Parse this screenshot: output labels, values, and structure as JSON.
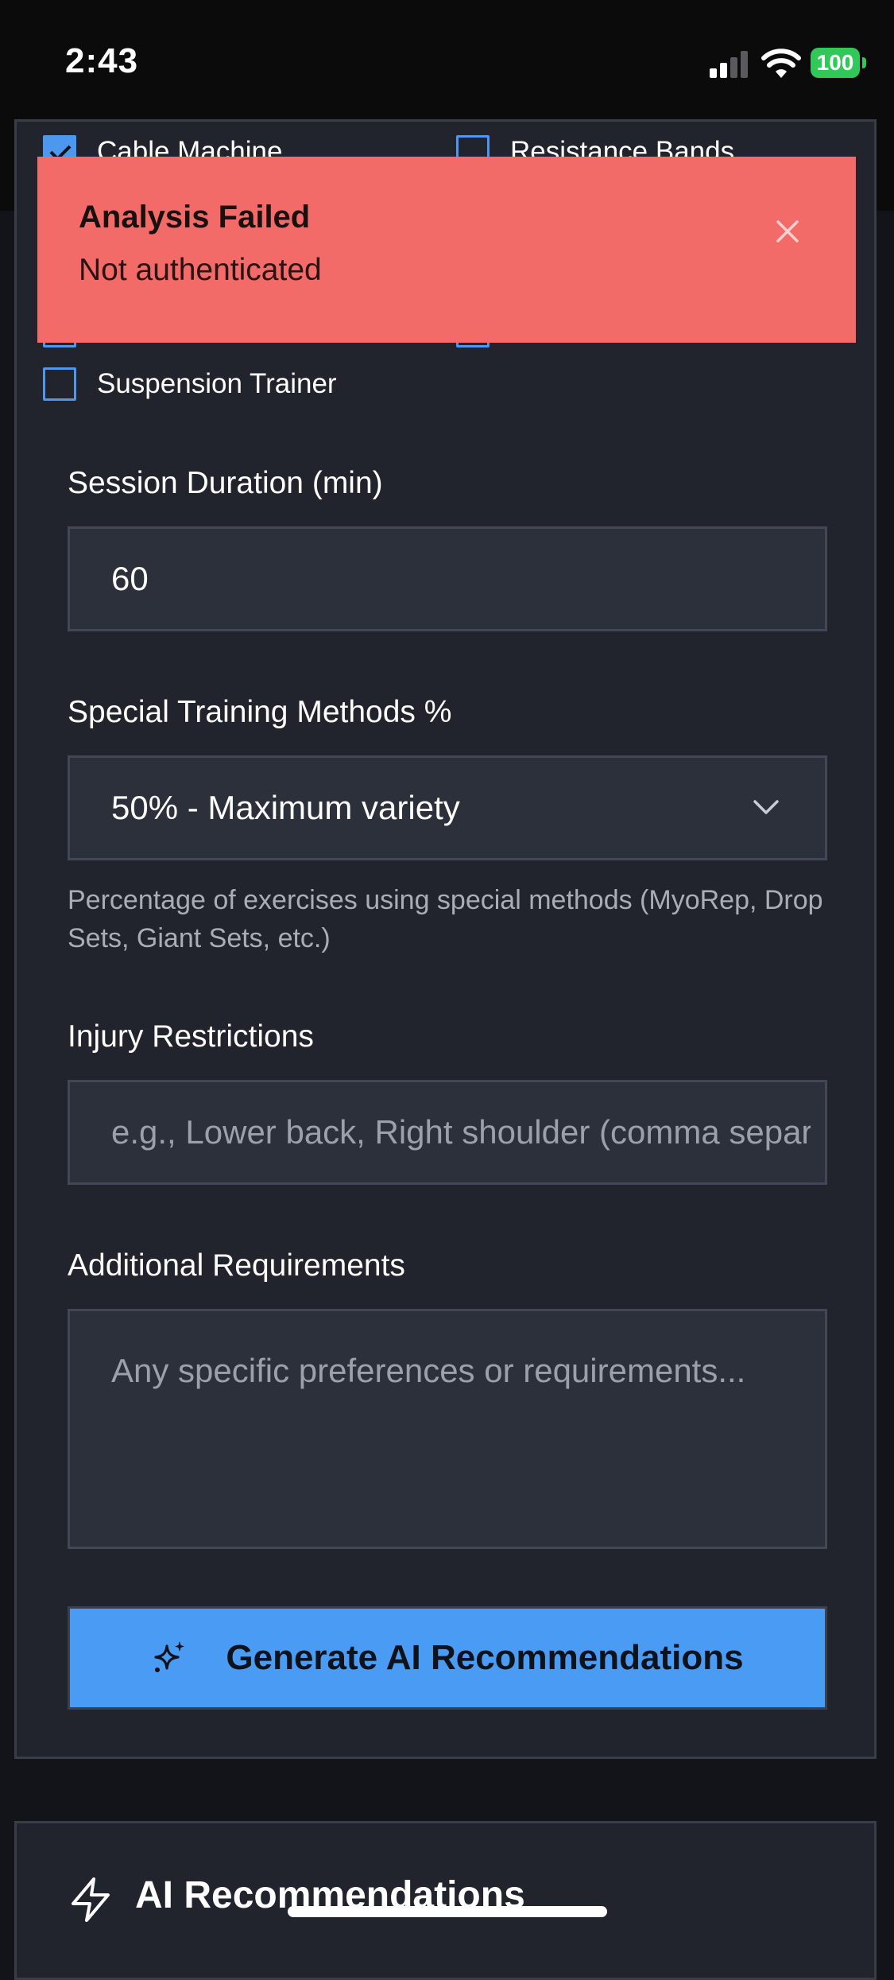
{
  "status_bar": {
    "time": "2:43",
    "battery": "100"
  },
  "equipment": {
    "items": [
      {
        "label": "Cable Machine",
        "checked": true
      },
      {
        "label": "Resistance Bands",
        "checked": false
      },
      {
        "label": "Suspension Trainer",
        "checked": false
      }
    ]
  },
  "toast": {
    "title": "Analysis Failed",
    "message": "Not authenticated"
  },
  "form": {
    "duration_label": "Session Duration (min)",
    "duration_value": "60",
    "methods_label": "Special Training Methods %",
    "methods_selected": "50% - Maximum variety",
    "methods_help": "Percentage of exercises using special methods (MyoRep, Drop Sets, Giant Sets, etc.)",
    "injury_label": "Injury Restrictions",
    "injury_placeholder": "e.g., Lower back, Right shoulder (comma separated)",
    "additional_label": "Additional Requirements",
    "additional_placeholder": "Any specific preferences or requirements...",
    "generate_button": "Generate AI Recommendations"
  },
  "recommendations": {
    "title": "AI Recommendations"
  },
  "colors": {
    "accent": "#4a9bf4",
    "error": "#f26b68",
    "card": "#21242c",
    "background": "#131419"
  }
}
